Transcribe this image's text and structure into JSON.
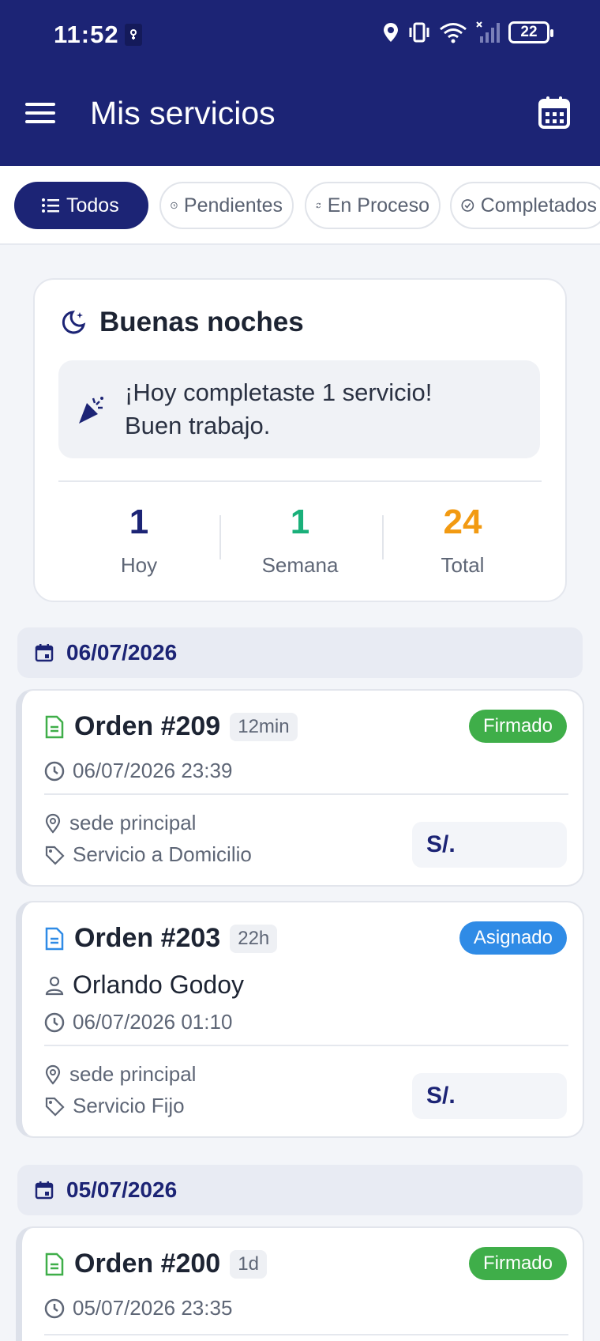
{
  "status_bar": {
    "time": "11:52",
    "battery": "22"
  },
  "app_bar": {
    "title": "Mis servicios"
  },
  "filters": [
    {
      "label": "Todos",
      "icon": "list-icon",
      "active": true
    },
    {
      "label": "Pendientes",
      "icon": "clock-icon",
      "active": false
    },
    {
      "label": "En Proceso",
      "icon": "sync-icon",
      "active": false
    },
    {
      "label": "Completados",
      "icon": "check-circle-icon",
      "active": false
    }
  ],
  "greeting": {
    "title": "Buenas noches",
    "message_line1": "¡Hoy completaste 1 servicio!",
    "message_line2": "Buen trabajo.",
    "stats": [
      {
        "value": "1",
        "label": "Hoy",
        "color": "#1c2475"
      },
      {
        "value": "1",
        "label": "Semana",
        "color": "#1ab07a"
      },
      {
        "value": "24",
        "label": "Total",
        "color": "#f29a12"
      }
    ]
  },
  "groups": [
    {
      "date": "06/07/2026",
      "orders": [
        {
          "title": "Orden #209",
          "age": "12min",
          "status": "Firmado",
          "status_color": "#3fae49",
          "icon_color": "#3fae49",
          "datetime": "06/07/2026 23:39",
          "location": "sede principal",
          "service": "Servicio a Domicilio",
          "price": "S/."
        },
        {
          "title": "Orden #203",
          "age": "22h",
          "status": "Asignado",
          "status_color": "#2f8be6",
          "icon_color": "#2f8be6",
          "client": "Orlando Godoy",
          "datetime": "06/07/2026 01:10",
          "location": "sede principal",
          "service": "Servicio Fijo",
          "price": "S/."
        }
      ]
    },
    {
      "date": "05/07/2026",
      "orders": [
        {
          "title": "Orden #200",
          "age": "1d",
          "status": "Firmado",
          "status_color": "#3fae49",
          "icon_color": "#3fae49",
          "datetime": "05/07/2026 23:35"
        }
      ]
    }
  ]
}
